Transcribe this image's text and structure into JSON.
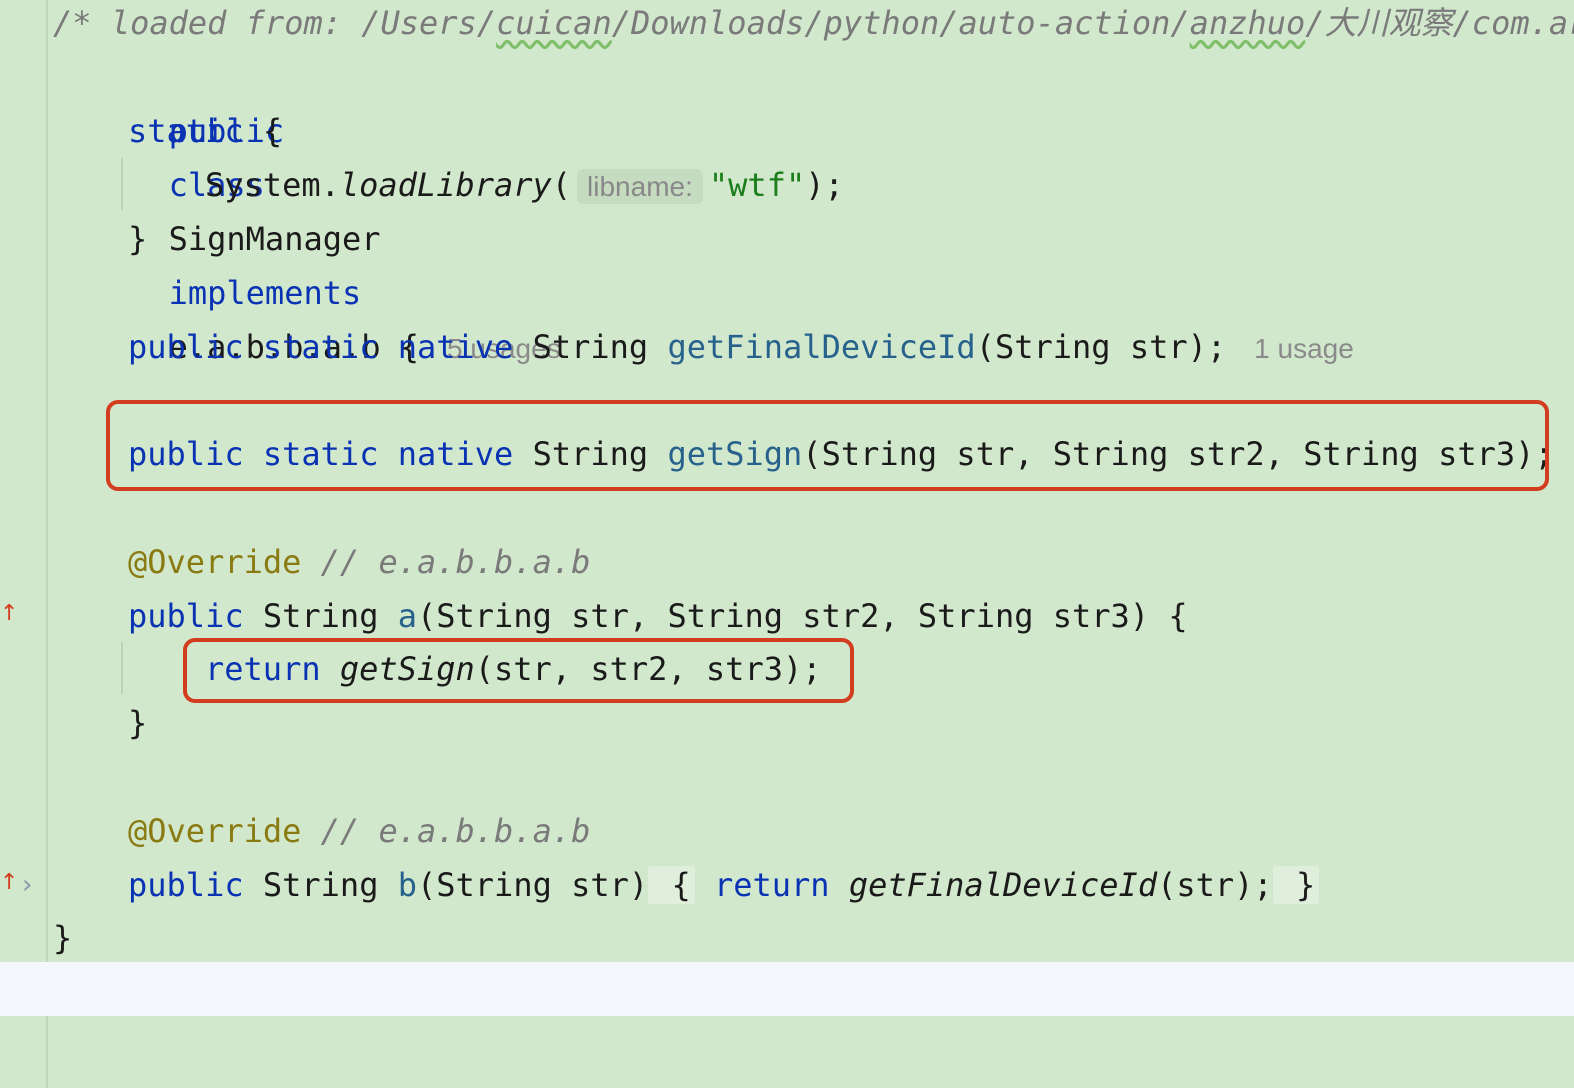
{
  "editor": {
    "comment_header": {
      "prefix": "/* loaded from: /Users/",
      "user": "cuican",
      "middle": "/Downloads/python/auto-action/",
      "dir": "anzhuo",
      "suffix": "/大川观察/com.ar"
    },
    "class_decl": {
      "kw_public": "public",
      "kw_class": "class",
      "name": "SignManager",
      "kw_implements": "implements",
      "iface": "e.a.b.b.a.b {",
      "usages": "5 usages"
    },
    "static_block": {
      "kw_static": "static",
      "open": " {",
      "call_prefix": "System.",
      "call_method": "loadLibrary",
      "call_open": "(",
      "inlay_hint": "libname:",
      "arg": "\"wtf\"",
      "call_close": ");",
      "close": "}"
    },
    "method_device_id": {
      "modifiers": [
        "public",
        "static",
        "native"
      ],
      "return_type": "String",
      "name": "getFinalDeviceId",
      "params": "(String str);",
      "usages": "1 usage"
    },
    "method_get_sign": {
      "modifiers": [
        "public",
        "static",
        "native"
      ],
      "return_type": "String",
      "name": "getSign",
      "params": "(String str, String str2, String str3);"
    },
    "override_a": {
      "annotation": "@Override",
      "comment": "// e.a.b.b.a.b",
      "kw_public": "public",
      "return_type": "String",
      "name": "a",
      "params": "(String str, String str2, String str3) {",
      "body_kw": "return",
      "body_call": "getSign",
      "body_args": "(str, str2, str3);",
      "close": "}"
    },
    "override_b": {
      "annotation": "@Override",
      "comment": "// e.a.b.b.a.b",
      "kw_public": "public",
      "return_type": "String",
      "name": "b",
      "params": "(String str)",
      "open_brace": " {",
      "body_kw": "return",
      "body_call": "getFinalDeviceId",
      "body_args": "(str);",
      "close_brace": " }"
    },
    "class_close": "}"
  },
  "colors": {
    "background": "#d2e8cd",
    "keyword": "#0a33b3",
    "string": "#1b7d1b",
    "highlight_box": "#d13d1e",
    "annotation": "#8a7a12"
  },
  "icons": {
    "override_marker": "override-arrow-icon",
    "fold": "chevron-right-icon"
  }
}
